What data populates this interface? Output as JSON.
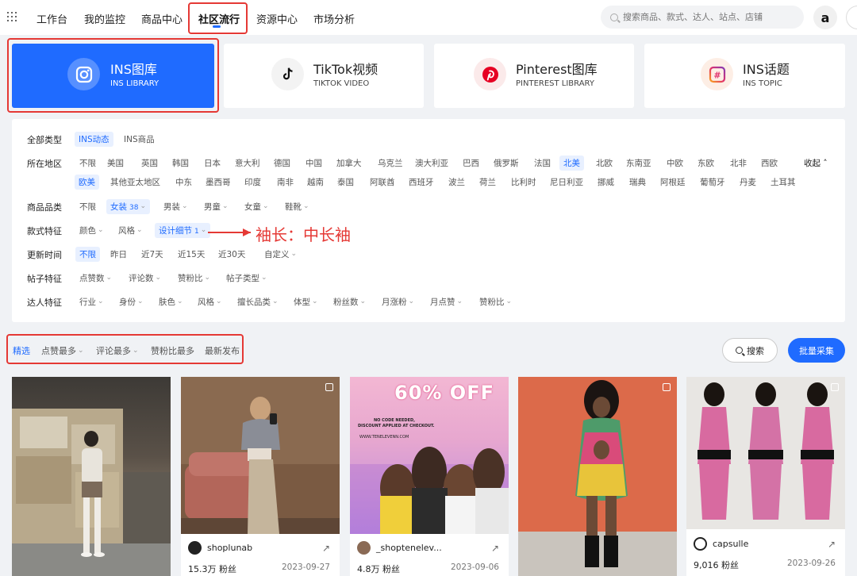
{
  "nav": {
    "items": [
      "工作台",
      "我的监控",
      "商品中心",
      "社区流行",
      "资源中心",
      "市场分析"
    ],
    "search_placeholder": "搜索商品、款式、达人、站点、店铺",
    "avatar_letter": "a"
  },
  "gallery_tabs": [
    {
      "title": "INS图库",
      "sub": "INS LIBRARY",
      "icon": "instagram-icon"
    },
    {
      "title": "TikTok视频",
      "sub": "TIKTOK VIDEO",
      "icon": "tiktok-icon"
    },
    {
      "title": "Pinterest图库",
      "sub": "PINTEREST LIBRARY",
      "icon": "pinterest-icon"
    },
    {
      "title": "INS话题",
      "sub": "INS TOPIC",
      "icon": "hashtag-icon"
    }
  ],
  "filters": {
    "type_label": "全部类型",
    "type_options": [
      "INS动态",
      "INS商品"
    ],
    "region_label": "所在地区",
    "region_row1": [
      "不限",
      "美国",
      "英国",
      "韩国",
      "日本",
      "意大利",
      "德国",
      "中国",
      "加拿大",
      "乌克兰",
      "澳大利亚",
      "巴西",
      "俄罗斯",
      "法国",
      "北美",
      "北欧",
      "东南亚",
      "中欧",
      "东欧",
      "北非",
      "西欧"
    ],
    "collapse_label": "收起",
    "region_row2": [
      "欧美",
      "其他亚太地区",
      "中东",
      "墨西哥",
      "印度",
      "南非",
      "越南",
      "泰国",
      "阿联酋",
      "西班牙",
      "波兰",
      "荷兰",
      "比利时",
      "尼日利亚",
      "挪威",
      "瑞典",
      "阿根廷",
      "葡萄牙",
      "丹麦",
      "土耳其"
    ],
    "category_label": "商品品类",
    "category_options": [
      "不限",
      "女装",
      "男装",
      "男童",
      "女童",
      "鞋靴"
    ],
    "category_count": "38",
    "style_label": "款式特征",
    "style_options": [
      "颜色",
      "风格",
      "设计细节"
    ],
    "style_count": "1",
    "update_label": "更新时间",
    "update_options": [
      "不限",
      "昨日",
      "近7天",
      "近15天",
      "近30天",
      "自定义"
    ],
    "post_label": "帖子特征",
    "post_options": [
      "点赞数",
      "评论数",
      "赞粉比",
      "帖子类型"
    ],
    "influencer_label": "达人特征",
    "influencer_options": [
      "行业",
      "身份",
      "肤色",
      "风格",
      "擅长品类",
      "体型",
      "粉丝数",
      "月涨粉",
      "月点赞",
      "赞粉比"
    ]
  },
  "annotation": "袖长：中长袖",
  "sort": {
    "options": [
      "精选",
      "点赞最多",
      "评论最多",
      "赞粉比最多",
      "最新发布"
    ],
    "search_label": "搜索",
    "batch_label": "批量采集"
  },
  "cards": [
    {
      "author": "",
      "fans": "",
      "date": ""
    },
    {
      "author": "shoplunab",
      "fans": "15.3万 粉丝",
      "date": "2023-09-27"
    },
    {
      "author": "_shoptenelev...",
      "fans": "4.8万 粉丝",
      "date": "2023-09-06",
      "banner": "60% OFF",
      "banner_small1": "NO CODE NEEDED,",
      "banner_small2": "DISCOUNT APPLIED AT CHECKOUT.",
      "banner_url": "WWW.TENELEVENN.COM"
    },
    {
      "author": "",
      "fans": "",
      "date": ""
    },
    {
      "author": "capsulle",
      "fans": "9,016 粉丝",
      "date": "2023-09-26"
    }
  ],
  "colors": {
    "accent": "#1f6bff",
    "annotation": "#e53935"
  }
}
